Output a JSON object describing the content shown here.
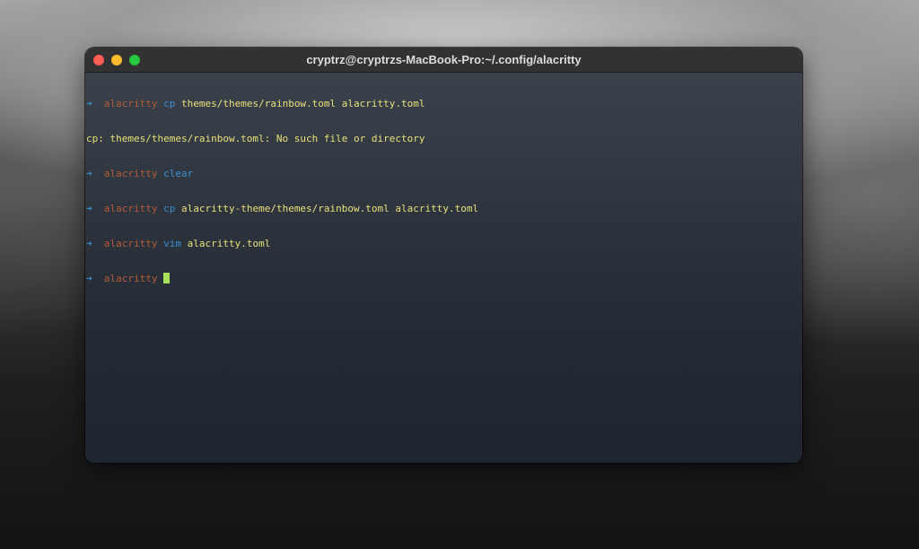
{
  "window": {
    "title": "cryptrz@cryptrzs-MacBook-Pro:~/.config/alacritty",
    "traffic_lights": [
      "close",
      "minimize",
      "zoom"
    ]
  },
  "colors": {
    "prompt_arrow": "#3d8fd0",
    "directory": "#b55a37",
    "command": "#3d8fd0",
    "argument": "#e8e07a",
    "cursor": "#a8e05a"
  },
  "terminal": {
    "arrow": "➜",
    "lines": [
      {
        "dir": "alacritty",
        "cmd": "cp",
        "args": "themes/themes/rainbow.toml alacritty.toml"
      },
      {
        "output": "cp: themes/themes/rainbow.toml: No such file or directory"
      },
      {
        "dir": "alacritty",
        "cmd": "clear",
        "args": ""
      },
      {
        "dir": "alacritty",
        "cmd": "cp",
        "args": "alacritty-theme/themes/rainbow.toml alacritty.toml"
      },
      {
        "dir": "alacritty",
        "cmd": "vim",
        "args": "alacritty.toml"
      },
      {
        "dir": "alacritty",
        "cmd": "",
        "args": ""
      }
    ]
  }
}
